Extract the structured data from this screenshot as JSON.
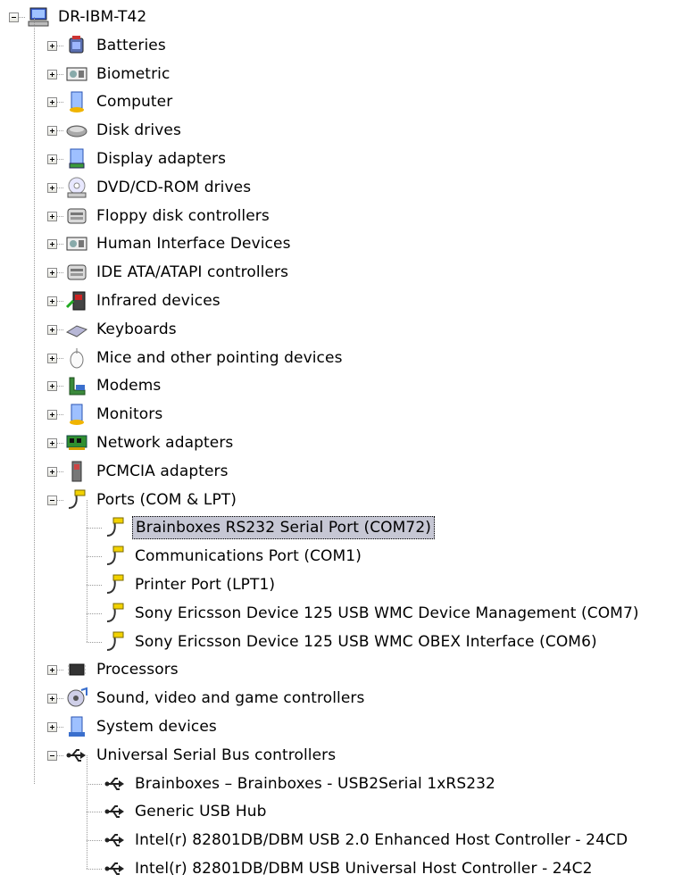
{
  "tree": {
    "root": {
      "label": "DR-IBM-T42",
      "icon": "computer-icon"
    },
    "categories": [
      {
        "label": "Batteries",
        "icon": "battery-icon",
        "expanded": false
      },
      {
        "label": "Biometric",
        "icon": "biometric-icon",
        "expanded": false
      },
      {
        "label": "Computer",
        "icon": "computer-monitor-icon",
        "expanded": false
      },
      {
        "label": "Disk drives",
        "icon": "disk-drive-icon",
        "expanded": false
      },
      {
        "label": "Display adapters",
        "icon": "display-adapter-icon",
        "expanded": false
      },
      {
        "label": "DVD/CD-ROM drives",
        "icon": "cd-drive-icon",
        "expanded": false
      },
      {
        "label": "Floppy disk controllers",
        "icon": "controller-icon",
        "expanded": false
      },
      {
        "label": "Human Interface Devices",
        "icon": "hid-icon",
        "expanded": false
      },
      {
        "label": "IDE ATA/ATAPI controllers",
        "icon": "controller-icon",
        "expanded": false
      },
      {
        "label": "Infrared devices",
        "icon": "infrared-icon",
        "expanded": false
      },
      {
        "label": "Keyboards",
        "icon": "keyboard-icon",
        "expanded": false
      },
      {
        "label": "Mice and other pointing devices",
        "icon": "mouse-icon",
        "expanded": false
      },
      {
        "label": "Modems",
        "icon": "modem-icon",
        "expanded": false
      },
      {
        "label": "Monitors",
        "icon": "monitor-icon",
        "expanded": false
      },
      {
        "label": "Network adapters",
        "icon": "network-adapter-icon",
        "expanded": false
      },
      {
        "label": "PCMCIA adapters",
        "icon": "pcmcia-icon",
        "expanded": false
      },
      {
        "label": "Ports (COM & LPT)",
        "icon": "port-icon",
        "expanded": true,
        "children": [
          {
            "label": "Brainboxes RS232 Serial Port (COM72)",
            "icon": "port-icon",
            "selected": true
          },
          {
            "label": "Communications Port (COM1)",
            "icon": "port-icon"
          },
          {
            "label": "Printer Port (LPT1)",
            "icon": "port-icon"
          },
          {
            "label": "Sony Ericsson Device 125 USB WMC Device Management (COM7)",
            "icon": "port-icon"
          },
          {
            "label": "Sony Ericsson Device 125 USB WMC OBEX Interface (COM6)",
            "icon": "port-icon"
          }
        ]
      },
      {
        "label": "Processors",
        "icon": "processor-icon",
        "expanded": false
      },
      {
        "label": "Sound, video and game controllers",
        "icon": "sound-icon",
        "expanded": false
      },
      {
        "label": "System devices",
        "icon": "system-device-icon",
        "expanded": false
      },
      {
        "label": "Universal Serial Bus controllers",
        "icon": "usb-icon",
        "expanded": true,
        "children": [
          {
            "label": "Brainboxes – Brainboxes - USB2Serial 1xRS232",
            "icon": "usb-icon"
          },
          {
            "label": "Generic USB Hub",
            "icon": "usb-icon"
          },
          {
            "label": "Intel(r) 82801DB/DBM USB 2.0 Enhanced Host Controller - 24CD",
            "icon": "usb-icon"
          },
          {
            "label": "Intel(r) 82801DB/DBM USB Universal Host Controller - 24C2",
            "icon": "usb-icon"
          }
        ]
      }
    ]
  }
}
